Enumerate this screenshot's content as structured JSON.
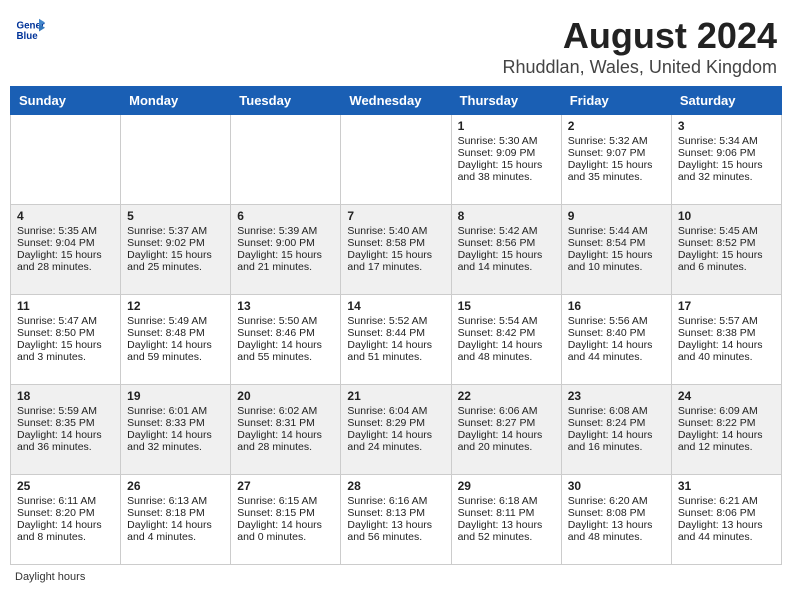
{
  "header": {
    "logo_line1": "General",
    "logo_line2": "Blue",
    "title": "August 2024",
    "subtitle": "Rhuddlan, Wales, United Kingdom"
  },
  "days_of_week": [
    "Sunday",
    "Monday",
    "Tuesday",
    "Wednesday",
    "Thursday",
    "Friday",
    "Saturday"
  ],
  "footer": {
    "note": "Daylight hours"
  },
  "weeks": [
    {
      "id": "week1",
      "cells": [
        {
          "day": "",
          "content": ""
        },
        {
          "day": "",
          "content": ""
        },
        {
          "day": "",
          "content": ""
        },
        {
          "day": "",
          "content": ""
        },
        {
          "day": "1",
          "content": "Sunrise: 5:30 AM\nSunset: 9:09 PM\nDaylight: 15 hours\nand 38 minutes."
        },
        {
          "day": "2",
          "content": "Sunrise: 5:32 AM\nSunset: 9:07 PM\nDaylight: 15 hours\nand 35 minutes."
        },
        {
          "day": "3",
          "content": "Sunrise: 5:34 AM\nSunset: 9:06 PM\nDaylight: 15 hours\nand 32 minutes."
        }
      ]
    },
    {
      "id": "week2",
      "cells": [
        {
          "day": "4",
          "content": "Sunrise: 5:35 AM\nSunset: 9:04 PM\nDaylight: 15 hours\nand 28 minutes."
        },
        {
          "day": "5",
          "content": "Sunrise: 5:37 AM\nSunset: 9:02 PM\nDaylight: 15 hours\nand 25 minutes."
        },
        {
          "day": "6",
          "content": "Sunrise: 5:39 AM\nSunset: 9:00 PM\nDaylight: 15 hours\nand 21 minutes."
        },
        {
          "day": "7",
          "content": "Sunrise: 5:40 AM\nSunset: 8:58 PM\nDaylight: 15 hours\nand 17 minutes."
        },
        {
          "day": "8",
          "content": "Sunrise: 5:42 AM\nSunset: 8:56 PM\nDaylight: 15 hours\nand 14 minutes."
        },
        {
          "day": "9",
          "content": "Sunrise: 5:44 AM\nSunset: 8:54 PM\nDaylight: 15 hours\nand 10 minutes."
        },
        {
          "day": "10",
          "content": "Sunrise: 5:45 AM\nSunset: 8:52 PM\nDaylight: 15 hours\nand 6 minutes."
        }
      ]
    },
    {
      "id": "week3",
      "cells": [
        {
          "day": "11",
          "content": "Sunrise: 5:47 AM\nSunset: 8:50 PM\nDaylight: 15 hours\nand 3 minutes."
        },
        {
          "day": "12",
          "content": "Sunrise: 5:49 AM\nSunset: 8:48 PM\nDaylight: 14 hours\nand 59 minutes."
        },
        {
          "day": "13",
          "content": "Sunrise: 5:50 AM\nSunset: 8:46 PM\nDaylight: 14 hours\nand 55 minutes."
        },
        {
          "day": "14",
          "content": "Sunrise: 5:52 AM\nSunset: 8:44 PM\nDaylight: 14 hours\nand 51 minutes."
        },
        {
          "day": "15",
          "content": "Sunrise: 5:54 AM\nSunset: 8:42 PM\nDaylight: 14 hours\nand 48 minutes."
        },
        {
          "day": "16",
          "content": "Sunrise: 5:56 AM\nSunset: 8:40 PM\nDaylight: 14 hours\nand 44 minutes."
        },
        {
          "day": "17",
          "content": "Sunrise: 5:57 AM\nSunset: 8:38 PM\nDaylight: 14 hours\nand 40 minutes."
        }
      ]
    },
    {
      "id": "week4",
      "cells": [
        {
          "day": "18",
          "content": "Sunrise: 5:59 AM\nSunset: 8:35 PM\nDaylight: 14 hours\nand 36 minutes."
        },
        {
          "day": "19",
          "content": "Sunrise: 6:01 AM\nSunset: 8:33 PM\nDaylight: 14 hours\nand 32 minutes."
        },
        {
          "day": "20",
          "content": "Sunrise: 6:02 AM\nSunset: 8:31 PM\nDaylight: 14 hours\nand 28 minutes."
        },
        {
          "day": "21",
          "content": "Sunrise: 6:04 AM\nSunset: 8:29 PM\nDaylight: 14 hours\nand 24 minutes."
        },
        {
          "day": "22",
          "content": "Sunrise: 6:06 AM\nSunset: 8:27 PM\nDaylight: 14 hours\nand 20 minutes."
        },
        {
          "day": "23",
          "content": "Sunrise: 6:08 AM\nSunset: 8:24 PM\nDaylight: 14 hours\nand 16 minutes."
        },
        {
          "day": "24",
          "content": "Sunrise: 6:09 AM\nSunset: 8:22 PM\nDaylight: 14 hours\nand 12 minutes."
        }
      ]
    },
    {
      "id": "week5",
      "cells": [
        {
          "day": "25",
          "content": "Sunrise: 6:11 AM\nSunset: 8:20 PM\nDaylight: 14 hours\nand 8 minutes."
        },
        {
          "day": "26",
          "content": "Sunrise: 6:13 AM\nSunset: 8:18 PM\nDaylight: 14 hours\nand 4 minutes."
        },
        {
          "day": "27",
          "content": "Sunrise: 6:15 AM\nSunset: 8:15 PM\nDaylight: 14 hours\nand 0 minutes."
        },
        {
          "day": "28",
          "content": "Sunrise: 6:16 AM\nSunset: 8:13 PM\nDaylight: 13 hours\nand 56 minutes."
        },
        {
          "day": "29",
          "content": "Sunrise: 6:18 AM\nSunset: 8:11 PM\nDaylight: 13 hours\nand 52 minutes."
        },
        {
          "day": "30",
          "content": "Sunrise: 6:20 AM\nSunset: 8:08 PM\nDaylight: 13 hours\nand 48 minutes."
        },
        {
          "day": "31",
          "content": "Sunrise: 6:21 AM\nSunset: 8:06 PM\nDaylight: 13 hours\nand 44 minutes."
        }
      ]
    }
  ]
}
